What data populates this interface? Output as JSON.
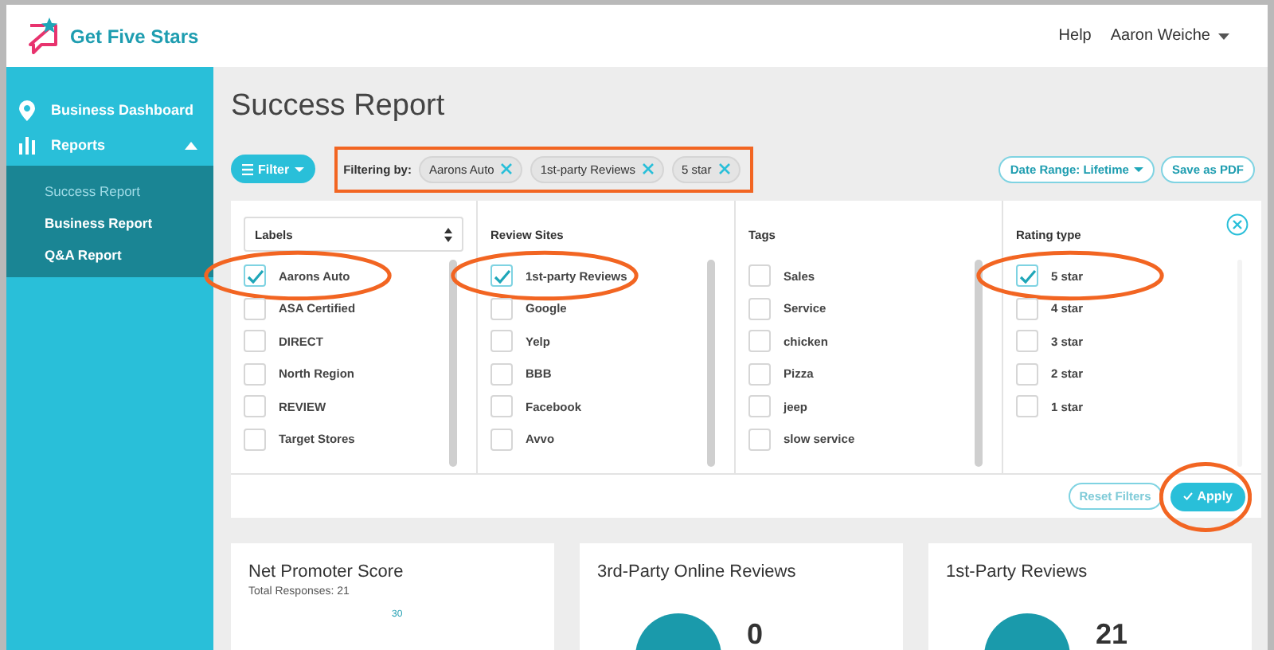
{
  "app": {
    "name": "Get Five Stars"
  },
  "header": {
    "help": "Help",
    "user": "Aaron Weiche"
  },
  "sidebar": {
    "items": [
      {
        "label": "Business Dashboard"
      },
      {
        "label": "Reports",
        "expanded": true,
        "children": [
          {
            "label": "Success Report",
            "selected": true
          },
          {
            "label": "Business Report",
            "selected": false
          },
          {
            "label": "Q&A Report",
            "selected": false
          }
        ]
      }
    ]
  },
  "page": {
    "title": "Success Report"
  },
  "toolbar": {
    "filter_button": "Filter",
    "filtering": {
      "label": "Filtering by:",
      "highlighted": true,
      "chips": [
        "Aarons Auto",
        "1st-party Reviews",
        "5 star"
      ]
    },
    "date_range": "Date Range: Lifetime",
    "save_button": "Save as PDF"
  },
  "filter_panel": {
    "columns": [
      {
        "kind": "select",
        "heading": "Labels",
        "items": [
          {
            "label": "Aarons Auto",
            "checked": true,
            "highlighted": true
          },
          {
            "label": "ASA Certified",
            "checked": false,
            "highlighted": false
          },
          {
            "label": "DIRECT",
            "checked": false,
            "highlighted": false
          },
          {
            "label": "North Region",
            "checked": false,
            "highlighted": false
          },
          {
            "label": "REVIEW",
            "checked": false,
            "highlighted": false
          },
          {
            "label": "Target Stores",
            "checked": false,
            "highlighted": false
          }
        ]
      },
      {
        "kind": "heading",
        "heading": "Review Sites",
        "items": [
          {
            "label": "1st-party Reviews",
            "checked": true,
            "highlighted": true
          },
          {
            "label": "Google",
            "checked": false,
            "highlighted": false
          },
          {
            "label": "Yelp",
            "checked": false,
            "highlighted": false
          },
          {
            "label": "BBB",
            "checked": false,
            "highlighted": false
          },
          {
            "label": "Facebook",
            "checked": false,
            "highlighted": false
          },
          {
            "label": "Avvo",
            "checked": false,
            "highlighted": false
          }
        ]
      },
      {
        "kind": "heading",
        "heading": "Tags",
        "items": [
          {
            "label": "Sales",
            "checked": false,
            "highlighted": false
          },
          {
            "label": "Service",
            "checked": false,
            "highlighted": false
          },
          {
            "label": "chicken",
            "checked": false,
            "highlighted": false
          },
          {
            "label": "Pizza",
            "checked": false,
            "highlighted": false
          },
          {
            "label": "jeep",
            "checked": false,
            "highlighted": false
          },
          {
            "label": "slow service",
            "checked": false,
            "highlighted": false
          }
        ]
      },
      {
        "kind": "heading",
        "heading": "Rating type",
        "items": [
          {
            "label": "5 star",
            "checked": true,
            "highlighted": true
          },
          {
            "label": "4 star",
            "checked": false,
            "highlighted": false
          },
          {
            "label": "3 star",
            "checked": false,
            "highlighted": false
          },
          {
            "label": "2 star",
            "checked": false,
            "highlighted": false
          },
          {
            "label": "1 star",
            "checked": false,
            "highlighted": false
          }
        ]
      }
    ],
    "reset_button": "Reset Filters",
    "apply_button": {
      "label": "Apply",
      "highlighted": true
    }
  },
  "cards": [
    {
      "kind": "nps",
      "title": "Net Promoter Score",
      "subtitle": "Total Responses: 21",
      "axis_label": "30"
    },
    {
      "kind": "count",
      "title": "3rd-Party Online Reviews",
      "value": "0"
    },
    {
      "kind": "count",
      "title": "1st-Party Reviews",
      "value": "21"
    }
  ]
}
